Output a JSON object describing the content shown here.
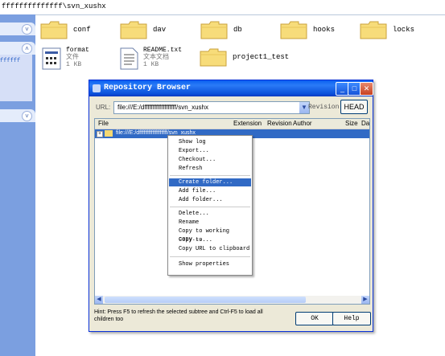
{
  "address": {
    "path": "ffffffffffffff\\svn_xushx"
  },
  "task_pane": {
    "item_text": "ffffff"
  },
  "files": [
    {
      "name": "conf"
    },
    {
      "name": "dav"
    },
    {
      "name": "db"
    },
    {
      "name": "hooks"
    },
    {
      "name": "locks"
    },
    {
      "name": "project1_test"
    }
  ],
  "docs": [
    {
      "name": "format",
      "type": "文件",
      "size": "1 KB"
    },
    {
      "name": "README.txt",
      "type": "文本文档",
      "size": "1 KB"
    }
  ],
  "dialog": {
    "title": "Repository Browser",
    "url_label": "URL:",
    "url_value": "file:///E:/dfffffffffffffffffff/svn_xushx",
    "revision_label": "Revision:",
    "head_button": "HEAD",
    "columns": [
      "File",
      "Extension",
      "Revision",
      "Author",
      "Size",
      "Da"
    ],
    "selected_row": "file:///E:/dfffffffffffffffffff/svn_xushx",
    "hint": "Hint: Press F5 to refresh the selected subtree and Ctrl-F5 to load all children too",
    "ok_button": "OK",
    "help_button": "Help"
  },
  "context_menu": {
    "items": [
      "Show log",
      "Export...",
      "Checkout...",
      "Refresh",
      "Create folder...",
      "Add file...",
      "Add folder...",
      "Delete...",
      "Rename",
      "Copy to working copy...",
      "Copy to...",
      "Copy URL to clipboard",
      "Show properties"
    ],
    "highlighted": "Create folder..."
  }
}
